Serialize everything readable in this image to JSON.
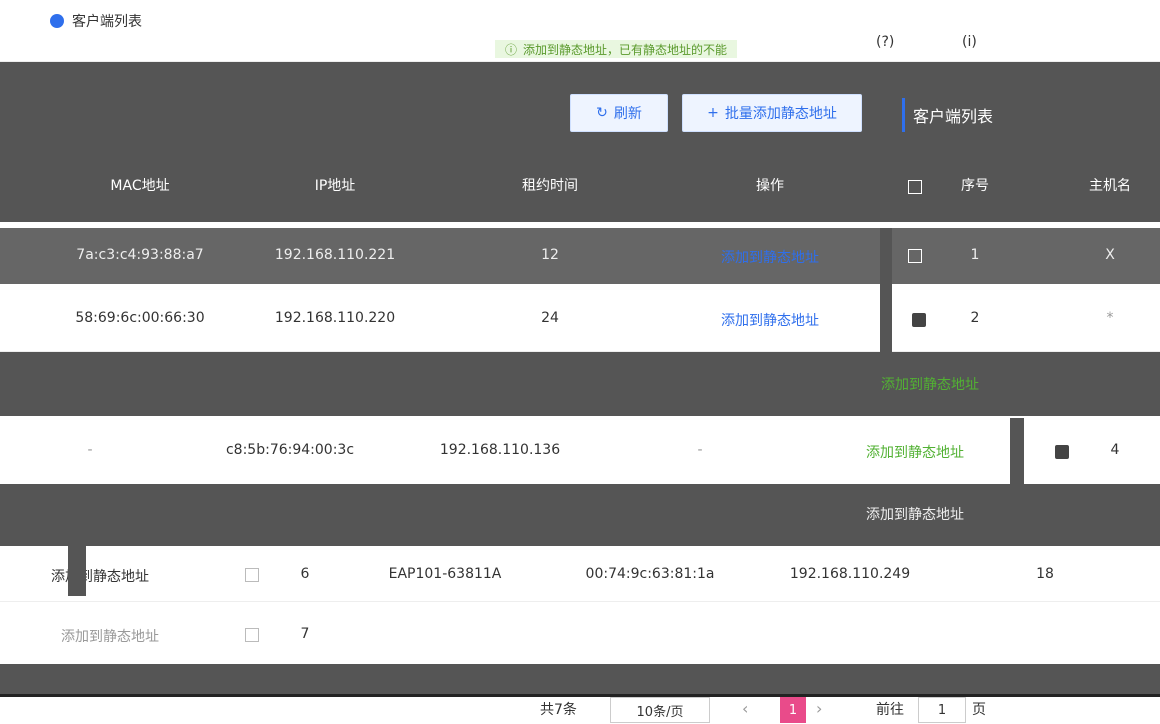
{
  "header": {
    "title": "客户端列表",
    "help": "(?)",
    "info": "(i)",
    "notice": "添加到静态地址，已有静态地址的不能"
  },
  "toolbar": {
    "refresh_label": "刷新",
    "refresh_icon": "refresh-icon",
    "batch_label": "批量添加静态地址",
    "batch_icon": "plus-icon",
    "panel_title": "客户端列表"
  },
  "columns": {
    "mac": "MAC地址",
    "ip": "IP地址",
    "lease": "租约时间",
    "op": "操作",
    "index": "序号",
    "host": "主机名"
  },
  "rows": [
    {
      "mac": "7a:c3:c4:93:88:a7",
      "ip": "192.168.110.221",
      "lease": "12",
      "op": "添加到静态地址",
      "index": "1",
      "host": "X"
    },
    {
      "mac": "58:69:6c:00:66:30",
      "ip": "192.168.110.220",
      "lease": "24",
      "op": "添加到静态地址",
      "index": "2",
      "host": "*"
    },
    {
      "op": "添加到静态地址"
    },
    {
      "host": "-",
      "mac": "c8:5b:76:94:00:3c",
      "ip": "192.168.110.136",
      "lease": "-",
      "op": "添加到静态地址",
      "index": "4"
    },
    {
      "op": "添加到静态地址"
    },
    {
      "op": "添加到静态地址",
      "index": "6",
      "host": "EAP101-63811A",
      "mac": "00:74:9c:63:81:1a",
      "ip": "192.168.110.249",
      "lease": "18"
    },
    {
      "op": "添加到静态地址",
      "index": "7"
    }
  ],
  "pagination": {
    "total": "共7条",
    "page_size": "10条/页",
    "prev": "‹",
    "current": "1",
    "next": "›",
    "goto_label": "前往",
    "goto_value": "1",
    "page_unit": "页"
  },
  "colors": {
    "accent": "#2f6fec",
    "link_green": "#52b133",
    "current_page": "#e94b8a"
  }
}
